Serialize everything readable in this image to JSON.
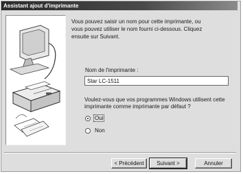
{
  "window": {
    "title": "Assistant ajout d'imprimante"
  },
  "intro": {
    "text": "Vous pouvez saisir un nom pour cette imprimante, ou\nvous pouvez utiliser le nom fourni ci-dessous. Cliquez\nensuite sur Suivant."
  },
  "printer_name": {
    "label": "Nom de l'imprimante :",
    "value": "Star LC-1511"
  },
  "default_question": {
    "text": "Voulez-vous que vos programmes Windows utilisent cette\nimprimante comme imprimante par défaut ?"
  },
  "radios": [
    {
      "label": "Oui",
      "selected": true
    },
    {
      "label": "Non",
      "selected": false
    }
  ],
  "buttons": {
    "back": "< Précédent",
    "next": "Suivant >",
    "cancel": "Annuler"
  }
}
